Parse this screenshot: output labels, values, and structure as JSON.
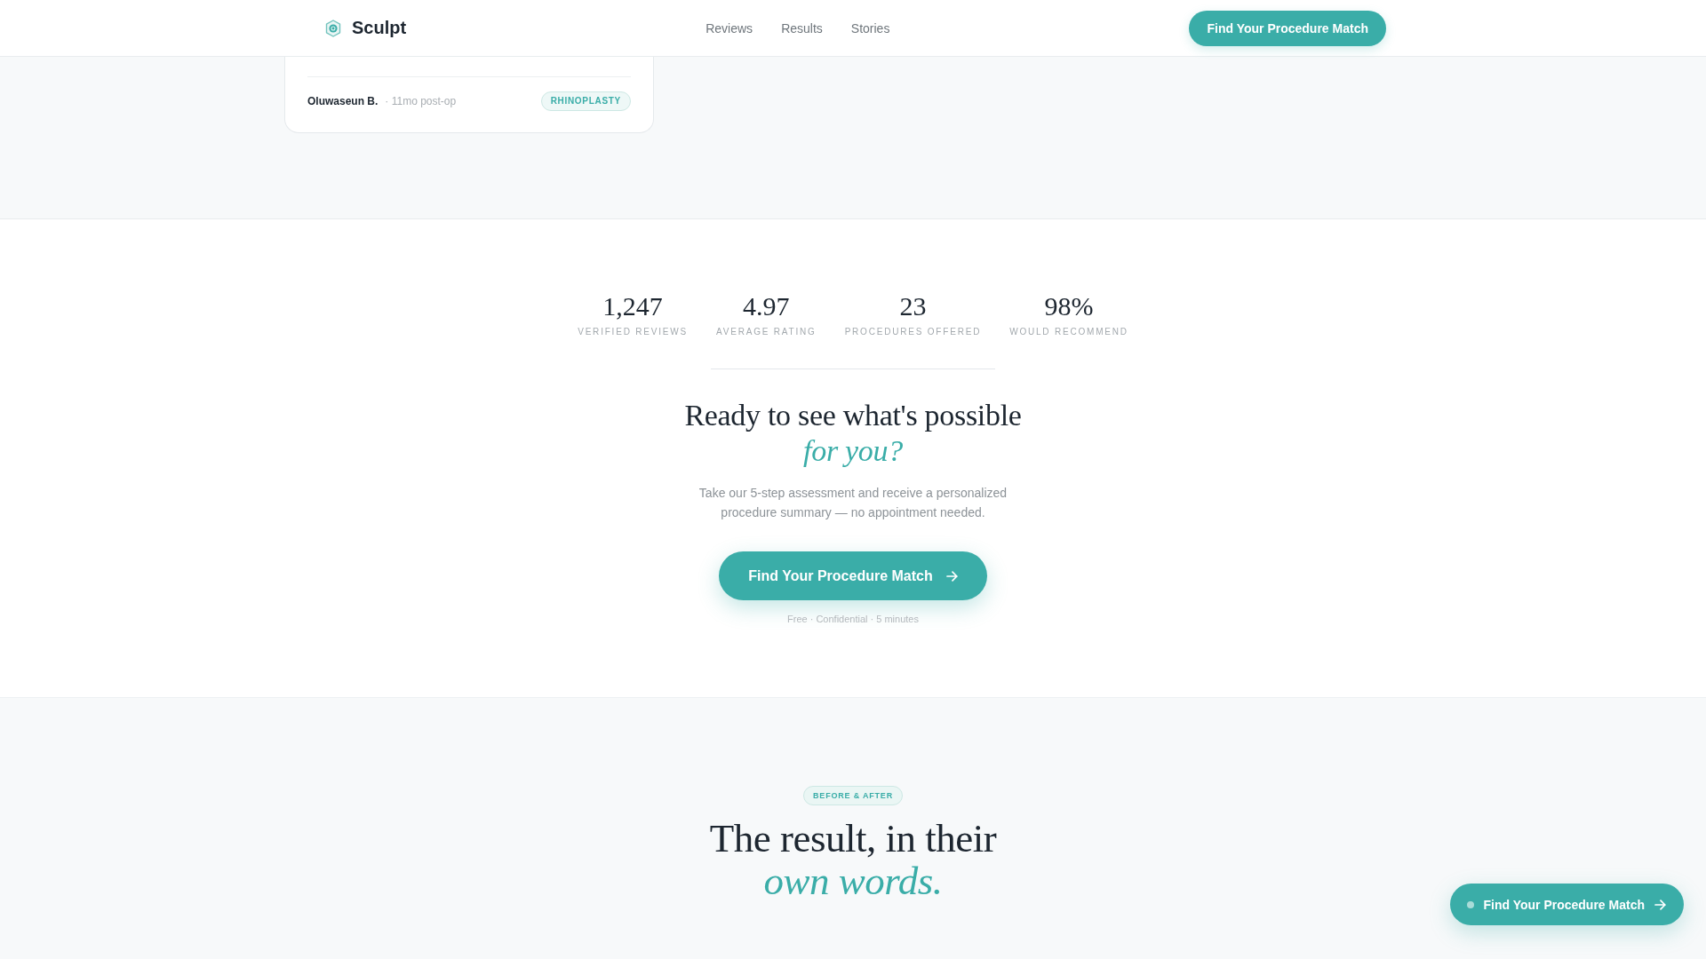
{
  "header": {
    "brand": "Sculpt",
    "nav": [
      "Reviews",
      "Results",
      "Stories"
    ],
    "cta": "Find Your Procedure Match"
  },
  "review_card": {
    "author": "Oluwaseun B.",
    "meta": "· 11mo post-op",
    "tag": "RHINOPLASTY"
  },
  "stats": [
    {
      "value": "1,247",
      "label": "VERIFIED REVIEWS"
    },
    {
      "value": "4.97",
      "label": "AVERAGE RATING"
    },
    {
      "value": "23",
      "label": "PROCEDURES OFFERED"
    },
    {
      "value": "98%",
      "label": "WOULD RECOMMEND"
    }
  ],
  "cta_section": {
    "heading": "Ready to see what's possible *for you?*",
    "text": "Take our 5-step assessment and receive a personalized procedure summary — no appointment needed.",
    "button": "Find Your Procedure Match",
    "note": "Free · Confidential · 5 minutes"
  },
  "results_section": {
    "tag": "BEFORE & AFTER",
    "heading": "The result, in their *own words.*"
  },
  "floating_button": {
    "label": "Find Your Procedure Match"
  }
}
